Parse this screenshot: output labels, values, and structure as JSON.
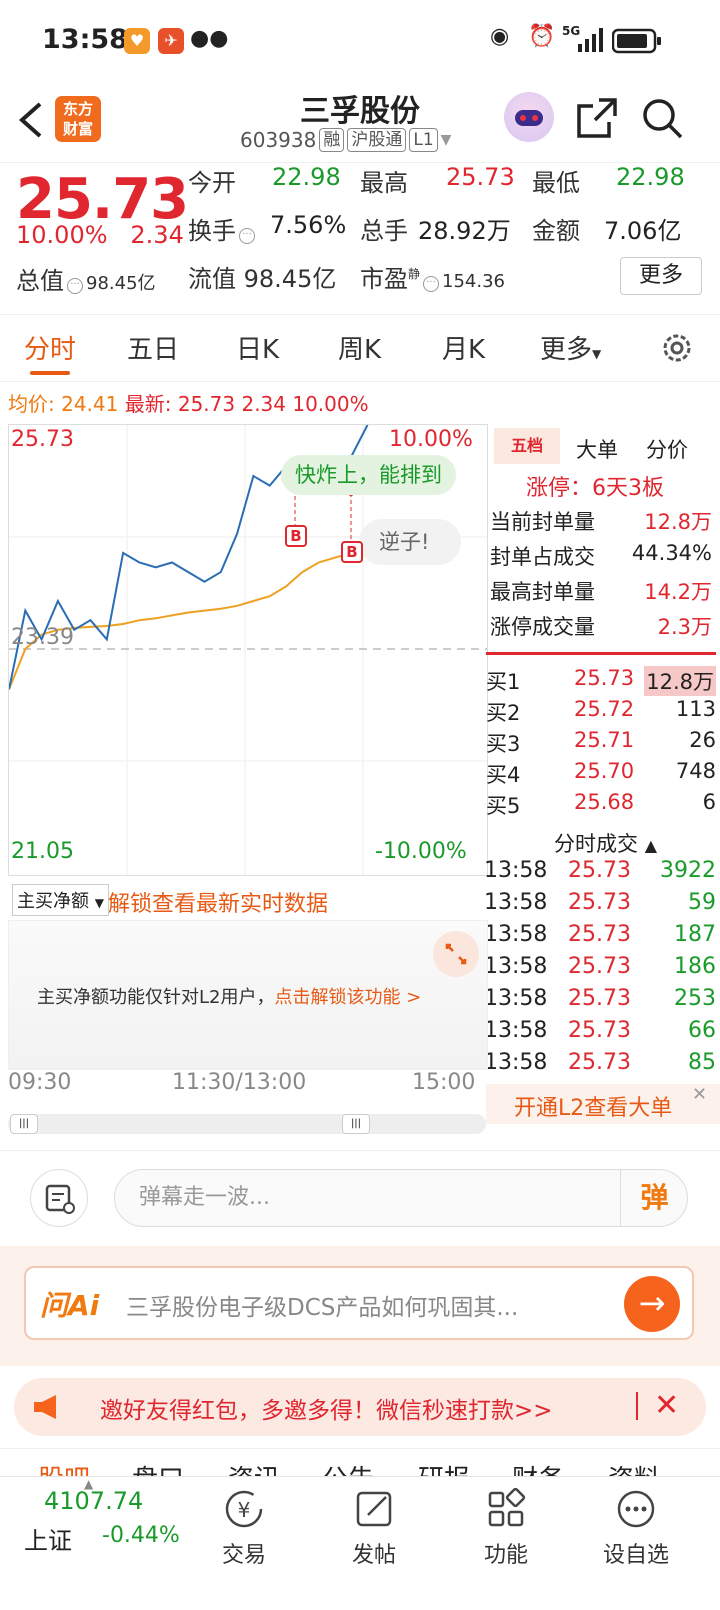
{
  "status_bar": {
    "time": "13:58",
    "network": "5G"
  },
  "header": {
    "logo_text_1": "东方",
    "logo_text_2": "财富",
    "title": "三孚股份",
    "code": "603938",
    "tags": [
      "融",
      "沪股通",
      "L1"
    ]
  },
  "quote": {
    "price": "25.73",
    "change_pct": "10.00%",
    "change_abs": "2.34",
    "rows": [
      [
        {
          "label": "今开",
          "value": "22.98",
          "color": "#1a9a2a"
        },
        {
          "label": "最高",
          "value": "25.73",
          "color": "#e0262f"
        },
        {
          "label": "最低",
          "value": "22.98",
          "color": "#1a9a2a"
        }
      ],
      [
        {
          "label": "换手",
          "value": "7.56%",
          "color": "#222"
        },
        {
          "label": "总手",
          "value": "28.92万",
          "color": "#222"
        },
        {
          "label": "金额",
          "value": "7.06亿",
          "color": "#222"
        }
      ]
    ],
    "total_value_label": "总值",
    "total_value": "98.45亿",
    "float_value_label": "流值",
    "float_value": "98.45亿",
    "pe_label": "市盈",
    "pe_sup": "静",
    "pe_value": "154.36",
    "more": "更多"
  },
  "tabs": [
    "分时",
    "五日",
    "日K",
    "周K",
    "月K",
    "更多"
  ],
  "legend": {
    "avg_label": "均价:",
    "avg": "24.41",
    "latest_label": "最新:",
    "latest": "25.73",
    "chg": "2.34",
    "pct": "10.00%"
  },
  "chart": {
    "y_top": "25.73",
    "y_mid": "23.39",
    "y_bottom": "21.05",
    "pct_top": "10.00%",
    "pct_bottom": "-10.00%",
    "bubble_1": "快炸上，能排到",
    "bubble_2": "逆子!",
    "marker": "B",
    "time_start": "09:30",
    "time_mid": "11:30/13:00",
    "time_end": "15:00"
  },
  "chart_data": {
    "type": "line",
    "ylim": [
      21.05,
      25.73
    ],
    "prev_close": 23.39,
    "series": [
      {
        "name": "均价",
        "values": [
          22.98,
          23.4,
          23.55,
          23.6,
          23.62,
          23.63,
          23.64,
          23.66,
          23.7,
          23.72,
          23.75,
          23.78,
          23.8,
          23.82,
          23.85,
          23.9,
          23.95,
          24.05,
          24.2,
          24.3,
          24.35,
          24.4,
          24.41
        ]
      },
      {
        "name": "价格",
        "values": [
          22.98,
          23.8,
          23.5,
          23.9,
          23.6,
          23.7,
          23.5,
          24.4,
          24.3,
          24.25,
          24.3,
          24.2,
          24.1,
          24.2,
          24.6,
          25.2,
          25.1,
          25.3,
          25.2,
          25.35,
          25.3,
          25.4,
          25.73
        ]
      }
    ]
  },
  "right_panel": {
    "tabs": [
      "五档",
      "大单",
      "分价"
    ],
    "limit_up": "涨停：6天3板",
    "stats": [
      {
        "label": "当前封单量",
        "value": "12.8万",
        "color": "#e0262f"
      },
      {
        "label": "封单占成交",
        "value": "44.34%",
        "color": "#222"
      },
      {
        "label": "最高封单量",
        "value": "14.2万",
        "color": "#e0262f"
      },
      {
        "label": "涨停成交量",
        "value": "2.3万",
        "color": "#e0262f"
      }
    ],
    "bids": [
      {
        "label": "买1",
        "price": "25.73",
        "vol": "12.8万"
      },
      {
        "label": "买2",
        "price": "25.72",
        "vol": "113"
      },
      {
        "label": "买3",
        "price": "25.71",
        "vol": "26"
      },
      {
        "label": "买4",
        "price": "25.70",
        "vol": "748"
      },
      {
        "label": "买5",
        "price": "25.68",
        "vol": "6"
      }
    ],
    "ticks_title": "分时成交",
    "ticks": [
      {
        "time": "13:58",
        "price": "25.73",
        "vol": "3922"
      },
      {
        "time": "13:58",
        "price": "25.73",
        "vol": "59"
      },
      {
        "time": "13:58",
        "price": "25.73",
        "vol": "187"
      },
      {
        "time": "13:58",
        "price": "25.73",
        "vol": "186"
      },
      {
        "time": "13:58",
        "price": "25.73",
        "vol": "253"
      },
      {
        "time": "13:58",
        "price": "25.73",
        "vol": "66"
      },
      {
        "time": "13:58",
        "price": "25.73",
        "vol": "85"
      }
    ],
    "l2_cta": "开通L2查看大单"
  },
  "netbuy": {
    "select": "主买净额",
    "unlock": "解锁查看最新实时数据",
    "msg": "主买净额功能仅针对L2用户，",
    "msg_link": "点击解锁该功能 >"
  },
  "comment": {
    "placeholder": "弹幕走一波...",
    "danmu": "弹"
  },
  "ai": {
    "logo": "问Ai",
    "text": "三孚股份电子级DCS产品如何巩固其..."
  },
  "promo": {
    "text": "邀好友得红包，多邀多得！微信秒速打款>>"
  },
  "bottom_tabs_peek": [
    "股吧",
    "盘口",
    "资讯",
    "公告",
    "研报",
    "财务",
    "资料"
  ],
  "index": {
    "value": "4107.74",
    "name": "上证",
    "chg": "-0.44%"
  },
  "nav": [
    {
      "label": "交易",
      "icon": "yuan-icon"
    },
    {
      "label": "发帖",
      "icon": "edit-icon"
    },
    {
      "label": "功能",
      "icon": "grid-icon"
    },
    {
      "label": "设自选",
      "icon": "dots-icon"
    }
  ]
}
